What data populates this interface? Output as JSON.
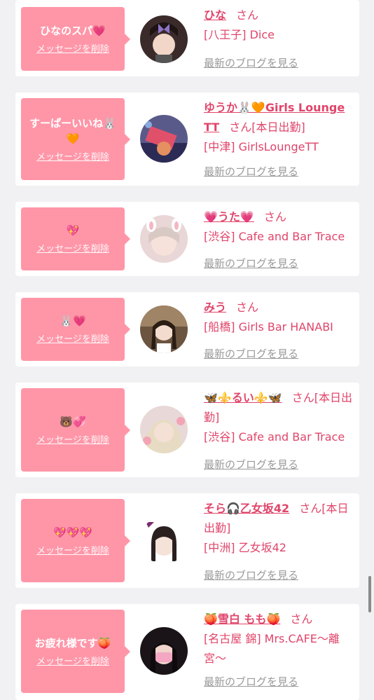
{
  "delete_label": "メッセージを削除",
  "blog_label": "最新のブログを見る",
  "san_label": "さん",
  "cards": [
    {
      "message": "ひなのスパ💗",
      "name": "ひな",
      "san": "さん",
      "shop": "[八王子] Dice"
    },
    {
      "message": "すーぱーいいね🐰🧡",
      "name": "ゆうか🐰🧡Girls Lounge TT",
      "san": "さん[本日出勤]",
      "shop": "[中津] GirlsLoungeTT"
    },
    {
      "message": "💖",
      "name": "💗うた💗",
      "san": "さん",
      "shop": "[渋谷] Cafe and Bar Trace"
    },
    {
      "message": "🐰💗",
      "name": "みう",
      "san": "さん",
      "shop": "[船橋] Girls Bar HANABI"
    },
    {
      "message": "🐻💞",
      "name": "🦋⚜️るい⚜️🦋",
      "san": "さん[本日出勤]",
      "shop": "[渋谷] Cafe and Bar Trace"
    },
    {
      "message": "💖💖💖",
      "name": "そら🎧乙女坂42",
      "san": "さん[本日出勤]",
      "shop": "[中洲] 乙女坂42"
    },
    {
      "message": "お疲れ様です🍑",
      "name": "🍑雪白 もも🍑",
      "san": "さん",
      "shop": "[名古屋 錦] Mrs.CAFE〜離宮〜"
    }
  ],
  "colors": {
    "accent": "#e0456a",
    "bubble": "#ff96a8",
    "link_gray": "#9a9a9a",
    "background": "#f1f1f3"
  }
}
